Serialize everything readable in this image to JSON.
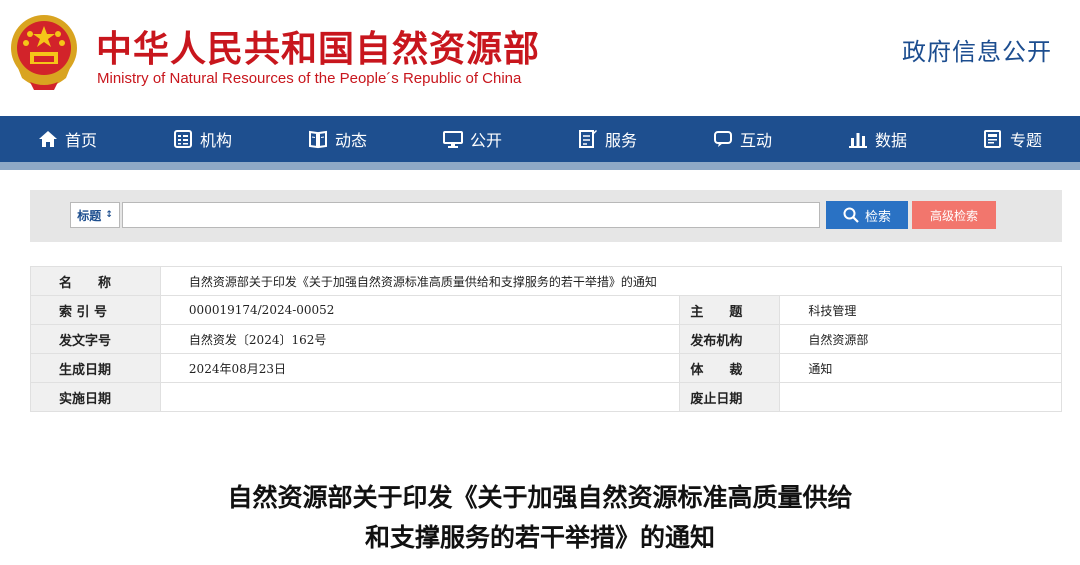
{
  "header": {
    "ministry_cn": "中华人民共和国自然资源部",
    "ministry_en": "Ministry of Natural Resources of the People´s Republic of China",
    "gov_info": "政府信息公开",
    "accent_red": "#c8161d",
    "accent_blue": "#1e4f8f"
  },
  "nav": {
    "items": [
      {
        "label": "首页",
        "icon": "home-icon"
      },
      {
        "label": "机构",
        "icon": "org-icon"
      },
      {
        "label": "动态",
        "icon": "book-icon"
      },
      {
        "label": "公开",
        "icon": "monitor-icon"
      },
      {
        "label": "服务",
        "icon": "document-edit-icon"
      },
      {
        "label": "互动",
        "icon": "chat-icon"
      },
      {
        "label": "数据",
        "icon": "bar-chart-icon"
      },
      {
        "label": "专题",
        "icon": "topic-icon"
      }
    ]
  },
  "search": {
    "field_select": "标题",
    "input_value": "",
    "search_label": "检索",
    "advanced_label": "高级检索"
  },
  "info": {
    "name_label": "名　　称",
    "name_value": "自然资源部关于印发《关于加强自然资源标准高质量供给和支撑服务的若干举措》的通知",
    "index_label": "索 引 号",
    "index_value": "000019174/2024-00052",
    "subject_label": "主　　题",
    "subject_value": "科技管理",
    "doc_no_label": "发文字号",
    "doc_no_value": "自然资发〔2024〕162号",
    "issuer_label": "发布机构",
    "issuer_value": "自然资源部",
    "date_label": "生成日期",
    "date_value": "2024年08月23日",
    "genre_label": "体　　裁",
    "genre_value": "通知",
    "effective_label": "实施日期",
    "effective_value": "",
    "expire_label": "废止日期",
    "expire_value": ""
  },
  "doc": {
    "title_line1": "自然资源部关于印发《关于加强自然资源标准高质量供给",
    "title_line2": "和支撑服务的若干举措》的通知"
  }
}
